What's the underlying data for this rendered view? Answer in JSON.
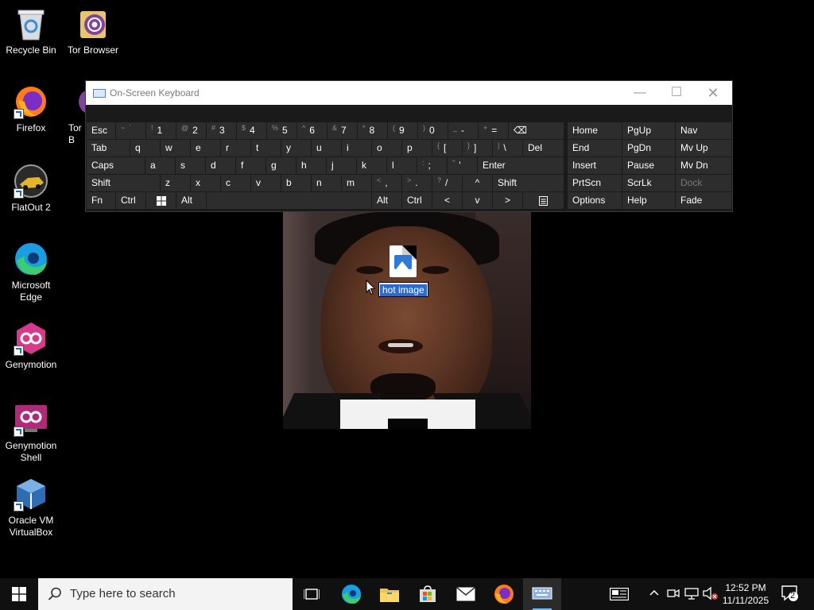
{
  "desktop_icons": [
    {
      "label": "Recycle Bin"
    },
    {
      "label": "Tor Browser"
    },
    {
      "label": "Firefox"
    },
    {
      "label": "Tor B"
    },
    {
      "label": "FlatOut 2"
    },
    {
      "label": "Microsoft Edge"
    },
    {
      "label": "Genymotion"
    },
    {
      "label": "Genymotion Shell"
    },
    {
      "label": "Oracle VM VirtualBox"
    }
  ],
  "osk": {
    "title": "On-Screen Keyboard",
    "row1": [
      "Esc",
      "~",
      "`",
      "!",
      "1",
      "@",
      "2",
      "#",
      "3",
      "$",
      "4",
      "%",
      "5",
      "^",
      "6",
      "&",
      "7",
      "*",
      "8",
      "(",
      "9",
      ")",
      "0",
      "_",
      "-",
      "+",
      "="
    ],
    "row1_extra": {
      "backspace": "⌫",
      "home": "Home",
      "pgup": "PgUp",
      "nav": "Nav"
    },
    "row2": {
      "tab": "Tab",
      "keys": [
        "q",
        "w",
        "e",
        "r",
        "t",
        "y",
        "u",
        "i",
        "o",
        "p"
      ],
      "lbrace": "{",
      "lbracket": "[",
      "rbrace": "}",
      "rbracket": "]",
      "pipe": "|",
      "backslash": "\\",
      "del": "Del",
      "end": "End",
      "pgdn": "PgDn",
      "mvup": "Mv Up"
    },
    "row3": {
      "caps": "Caps",
      "keys": [
        "a",
        "s",
        "d",
        "f",
        "g",
        "h",
        "j",
        "k",
        "l"
      ],
      "colon": ":",
      "semi": ";",
      "quote": "\"",
      "apos": "'",
      "enter": "Enter",
      "insert": "Insert",
      "pause": "Pause",
      "mvdn": "Mv Dn"
    },
    "row4": {
      "shift": "Shift",
      "keys": [
        "z",
        "x",
        "c",
        "v",
        "b",
        "n",
        "m"
      ],
      "lt": "<",
      "comma": ",",
      "gt": ">",
      "period": ".",
      "qmark": "?",
      "slash": "/",
      "up": "^",
      "shift_r": "Shift",
      "prtscn": "PrtScn",
      "scrlk": "ScrLk",
      "dock": "Dock"
    },
    "row5": {
      "fn": "Fn",
      "ctrl": "Ctrl",
      "alt": "Alt",
      "alt_r": "Alt",
      "ctrl_r": "Ctrl",
      "left": "<",
      "down": "v",
      "right": ">",
      "options": "Options",
      "help": "Help",
      "fade": "Fade"
    }
  },
  "drag": {
    "filename": "hot image"
  },
  "taskbar": {
    "search_placeholder": "Type here to search",
    "time": "12:52 PM",
    "date": "11/11/2025",
    "notifications": "2"
  }
}
